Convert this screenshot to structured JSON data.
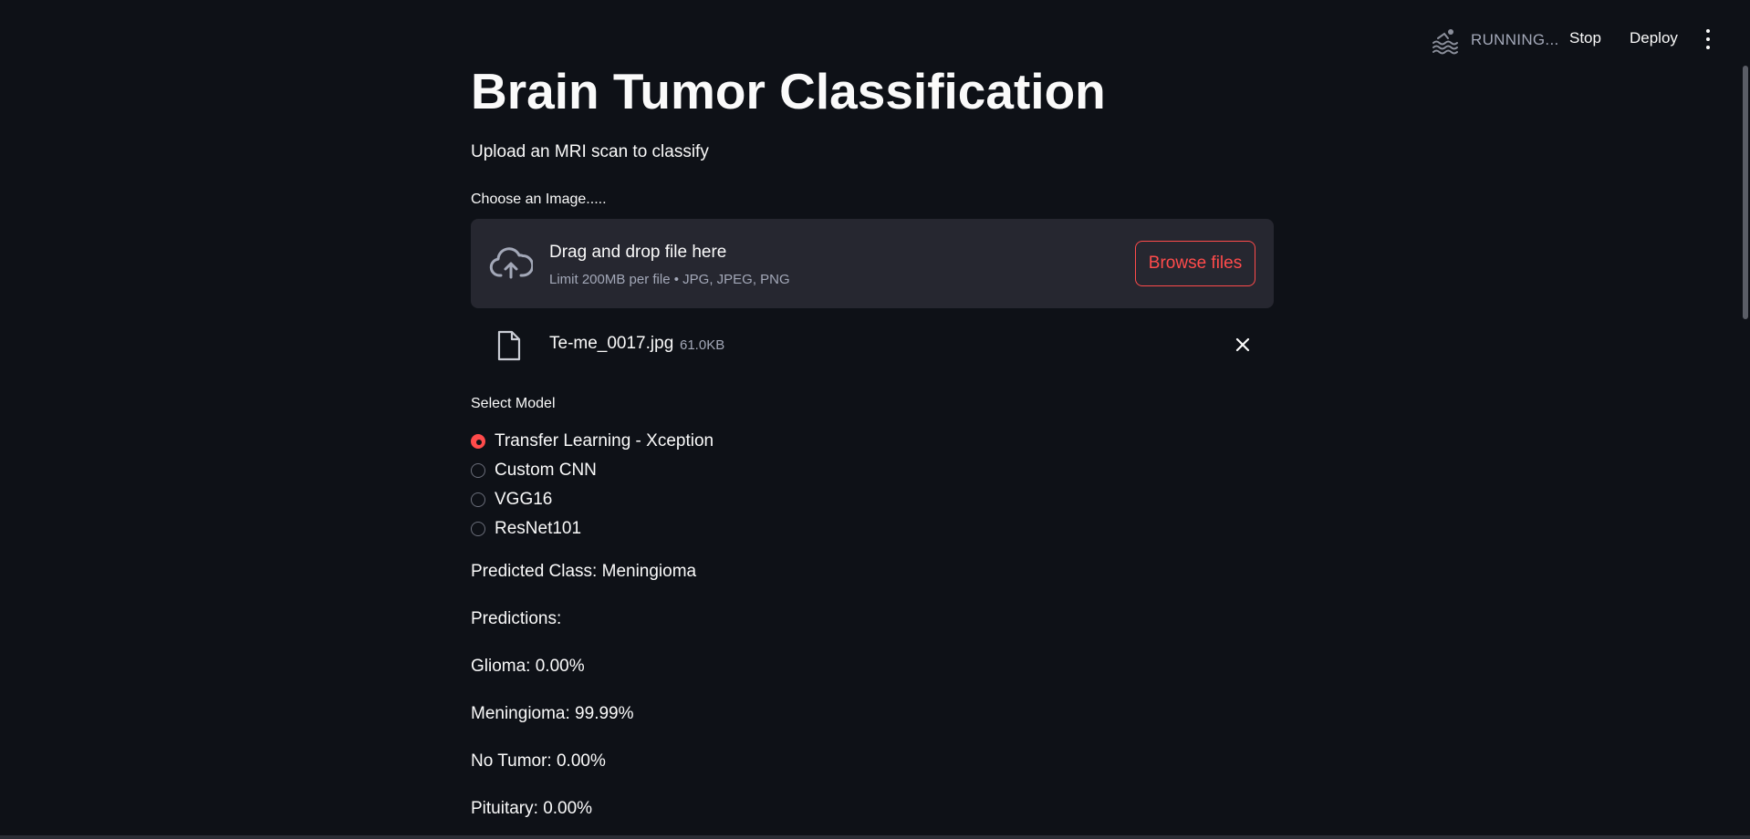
{
  "header": {
    "status_icon": "swimmer-icon",
    "status_text": "RUNNING...",
    "stop_label": "Stop",
    "deploy_label": "Deploy",
    "menu_icon": "more-vertical-icon"
  },
  "page": {
    "title": "Brain Tumor Classification",
    "subtitle": "Upload an MRI scan to classify"
  },
  "uploader": {
    "label": "Choose an Image.....",
    "icon": "cloud-upload-icon",
    "drop_text": "Drag and drop file here",
    "limit_text": "Limit 200MB per file • JPG, JPEG, PNG",
    "browse_label": "Browse files",
    "file": {
      "icon": "file-icon",
      "name": "Te-me_0017.jpg",
      "size": "61.0KB",
      "remove_icon": "close-icon"
    }
  },
  "model_select": {
    "label": "Select Model",
    "options": [
      {
        "label": "Transfer Learning - Xception",
        "selected": true
      },
      {
        "label": "Custom CNN",
        "selected": false
      },
      {
        "label": "VGG16",
        "selected": false
      },
      {
        "label": "ResNet101",
        "selected": false
      }
    ]
  },
  "results": {
    "predicted_class": "Predicted Class: Meningioma",
    "predictions_heading": "Predictions:",
    "lines": [
      "Glioma: 0.00%",
      "Meningioma: 99.99%",
      "No Tumor: 0.00%",
      "Pituitary: 0.00%"
    ]
  },
  "colors": {
    "background": "#0e1117",
    "accent": "#ff4b4b",
    "panel": "#262730",
    "muted_text": "#a3a8b8"
  }
}
